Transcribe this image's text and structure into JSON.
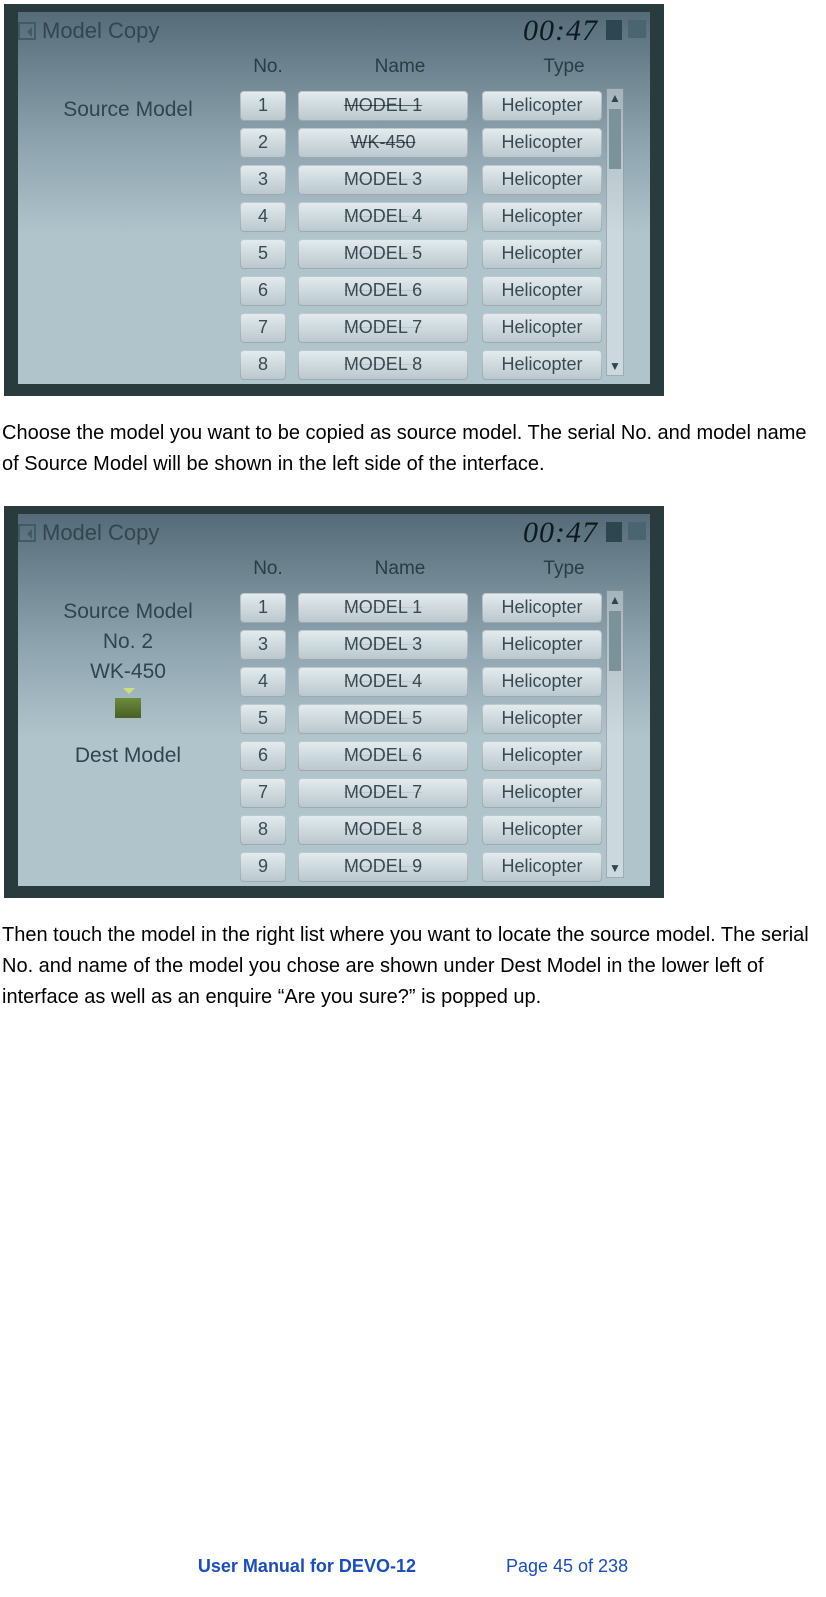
{
  "footer": {
    "title": "User Manual for DEVO-12",
    "page": "Page 45 of 238"
  },
  "para1": "Choose the model you want to be copied as source model. The serial No. and model name of Source Model will be shown in the left side of the interface.",
  "para2": "Then touch the model in the right list where you want to locate the source model. The serial No. and name of the model you chose are shown under Dest Model in the lower left of interface as well as an enquire “Are you sure?” is popped up.",
  "shot1": {
    "title": "Model Copy",
    "clock": "00:47",
    "side": {
      "label": "Source Model"
    },
    "headers": {
      "no": "No.",
      "name": "Name",
      "type": "Type"
    },
    "rows": [
      {
        "no": "1",
        "name": "MODEL 1",
        "type": "Helicopter",
        "strike": true
      },
      {
        "no": "2",
        "name": "WK-450",
        "type": "Helicopter",
        "strike": true
      },
      {
        "no": "3",
        "name": "MODEL 3",
        "type": "Helicopter"
      },
      {
        "no": "4",
        "name": "MODEL 4",
        "type": "Helicopter"
      },
      {
        "no": "5",
        "name": "MODEL 5",
        "type": "Helicopter"
      },
      {
        "no": "6",
        "name": "MODEL 6",
        "type": "Helicopter"
      },
      {
        "no": "7",
        "name": "MODEL 7",
        "type": "Helicopter"
      },
      {
        "no": "8",
        "name": "MODEL 8",
        "type": "Helicopter"
      }
    ]
  },
  "shot2": {
    "title": "Model Copy",
    "clock": "00:47",
    "side": {
      "label": "Source Model",
      "no_label": "No. 2",
      "name": "WK-450",
      "dest_label": "Dest Model"
    },
    "headers": {
      "no": "No.",
      "name": "Name",
      "type": "Type"
    },
    "rows": [
      {
        "no": "1",
        "name": "MODEL 1",
        "type": "Helicopter"
      },
      {
        "no": "3",
        "name": "MODEL 3",
        "type": "Helicopter"
      },
      {
        "no": "4",
        "name": "MODEL 4",
        "type": "Helicopter"
      },
      {
        "no": "5",
        "name": "MODEL 5",
        "type": "Helicopter"
      },
      {
        "no": "6",
        "name": "MODEL 6",
        "type": "Helicopter"
      },
      {
        "no": "7",
        "name": "MODEL 7",
        "type": "Helicopter"
      },
      {
        "no": "8",
        "name": "MODEL 8",
        "type": "Helicopter"
      },
      {
        "no": "9",
        "name": "MODEL 9",
        "type": "Helicopter"
      }
    ]
  }
}
